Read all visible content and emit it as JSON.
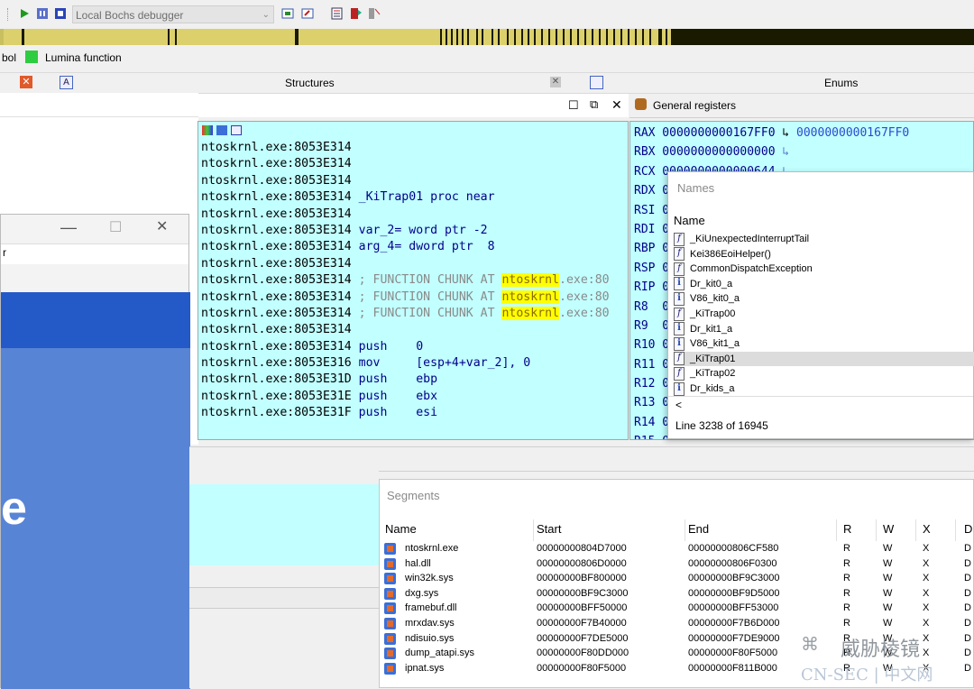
{
  "toolbar": {
    "debugger_select": "Local Bochs debugger"
  },
  "legend": {
    "symbol_partial": "bol",
    "lumina": "Lumina function",
    "lumina_color": "#2ecc40"
  },
  "tabs": {
    "structures": "Structures",
    "enums": "Enums"
  },
  "disasm": {
    "lines": [
      {
        "addr": "ntoskrnl.exe:8053E314",
        "text": ""
      },
      {
        "addr": "ntoskrnl.exe:8053E314",
        "text": ""
      },
      {
        "addr": "ntoskrnl.exe:8053E314",
        "text": ""
      },
      {
        "addr": "ntoskrnl.exe:8053E314",
        "text": " _KiTrap01 proc near"
      },
      {
        "addr": "ntoskrnl.exe:8053E314",
        "text": ""
      },
      {
        "addr": "ntoskrnl.exe:8053E314",
        "text": " var_2= word ptr -2"
      },
      {
        "addr": "ntoskrnl.exe:8053E314",
        "text": " arg_4= dword ptr  8"
      },
      {
        "addr": "ntoskrnl.exe:8053E314",
        "text": ""
      },
      {
        "addr": "ntoskrnl.exe:8053E314",
        "comment_pre": " ; FUNCTION CHUNK AT ",
        "hl": "ntoskrnl",
        "comment_post": ".exe:80"
      },
      {
        "addr": "ntoskrnl.exe:8053E314",
        "comment_pre": " ; FUNCTION CHUNK AT ",
        "hl": "ntoskrnl",
        "comment_post": ".exe:80"
      },
      {
        "addr": "ntoskrnl.exe:8053E314",
        "comment_pre": " ; FUNCTION CHUNK AT ",
        "hl": "ntoskrnl",
        "comment_post": ".exe:80"
      },
      {
        "addr": "ntoskrnl.exe:8053E314",
        "text": ""
      },
      {
        "addr": "ntoskrnl.exe:8053E314",
        "text": " push    0"
      },
      {
        "addr": "ntoskrnl.exe:8053E316",
        "text": " mov     [esp+4+var_2], 0"
      },
      {
        "addr": "ntoskrnl.exe:8053E31D",
        "text": " push    ebp"
      },
      {
        "addr": "ntoskrnl.exe:8053E31E",
        "text": " push    ebx"
      },
      {
        "addr": "ntoskrnl.exe:8053E31F",
        "text": " push    esi"
      }
    ]
  },
  "registers": {
    "title": "General registers",
    "rows": [
      {
        "name": "RAX",
        "value": "0000000000167FF0",
        "extra": "0000000000167FF0"
      },
      {
        "name": "RBX",
        "value": "0000000000000000",
        "extra": ""
      },
      {
        "name": "RCX",
        "value": "0000000000000644",
        "extra": ""
      },
      {
        "name": "RDX",
        "value": "00",
        "extra": ""
      },
      {
        "name": "RSI",
        "value": "00",
        "extra": ""
      },
      {
        "name": "RDI",
        "value": "00",
        "extra": ""
      },
      {
        "name": "RBP",
        "value": "00",
        "extra": ""
      },
      {
        "name": "RSP",
        "value": "00",
        "extra": ""
      },
      {
        "name": "RIP",
        "value": "00",
        "extra": ""
      },
      {
        "name": "R8",
        "value": " 00",
        "extra": ""
      },
      {
        "name": "R9",
        "value": " 00",
        "extra": ""
      },
      {
        "name": "R10",
        "value": "00",
        "extra": ""
      },
      {
        "name": "R11",
        "value": "00",
        "extra": ""
      },
      {
        "name": "R12",
        "value": "00",
        "extra": ""
      },
      {
        "name": "R13",
        "value": "00",
        "extra": ""
      },
      {
        "name": "R14",
        "value": "00",
        "extra": ""
      },
      {
        "name": "R15",
        "value": "0000000000000000",
        "extra": ""
      }
    ]
  },
  "names": {
    "title": "Names",
    "column": "Name",
    "items": [
      {
        "icon": "f",
        "label": "_KiUnexpectedInterruptTail"
      },
      {
        "icon": "f",
        "label": "Kei386EoiHelper()"
      },
      {
        "icon": "f",
        "label": "CommonDispatchException"
      },
      {
        "icon": "i",
        "label": "Dr_kit0_a"
      },
      {
        "icon": "i",
        "label": "V86_kit0_a"
      },
      {
        "icon": "f",
        "label": "_KiTrap00"
      },
      {
        "icon": "i",
        "label": "Dr_kit1_a"
      },
      {
        "icon": "i",
        "label": "V86_kit1_a"
      },
      {
        "icon": "f",
        "label": "_KiTrap01"
      },
      {
        "icon": "f",
        "label": "_KiTrap02"
      },
      {
        "icon": "i",
        "label": "Dr_kids_a"
      }
    ],
    "selected": "_KiTrap01",
    "status": "Line 3238 of 16945",
    "scroll_left": "<"
  },
  "segments": {
    "title": "Segments",
    "headers": [
      "Name",
      "Start",
      "End",
      "R",
      "W",
      "X",
      "D"
    ],
    "rows": [
      [
        "ntoskrnl.exe",
        "00000000804D7000",
        "00000000806CF580",
        "R",
        "W",
        "X",
        "D"
      ],
      [
        "hal.dll",
        "00000000806D0000",
        "00000000806F0300",
        "R",
        "W",
        "X",
        "D"
      ],
      [
        "win32k.sys",
        "00000000BF800000",
        "00000000BF9C3000",
        "R",
        "W",
        "X",
        "D"
      ],
      [
        "dxg.sys",
        "00000000BF9C3000",
        "00000000BF9D5000",
        "R",
        "W",
        "X",
        "D"
      ],
      [
        "framebuf.dll",
        "00000000BFF50000",
        "00000000BFF53000",
        "R",
        "W",
        "X",
        "D"
      ],
      [
        "mrxdav.sys",
        "00000000F7B40000",
        "00000000F7B6D000",
        "R",
        "W",
        "X",
        "D"
      ],
      [
        "ndisuio.sys",
        "00000000F7DE5000",
        "00000000F7DE9000",
        "R",
        "W",
        "X",
        "D"
      ],
      [
        "dump_atapi.sys",
        "00000000F80DD000",
        "00000000F80F5000",
        "R",
        "W",
        "X",
        "D"
      ],
      [
        "ipnat.sys",
        "00000000F80F5000",
        "00000000F811B000",
        "R",
        "W",
        "X",
        "D"
      ]
    ]
  },
  "floatwin": {
    "letter": "e",
    "partial": "r"
  },
  "watermark": {
    "line1": "威胁棱镜",
    "line2": "CN-SEC | 中文网"
  }
}
